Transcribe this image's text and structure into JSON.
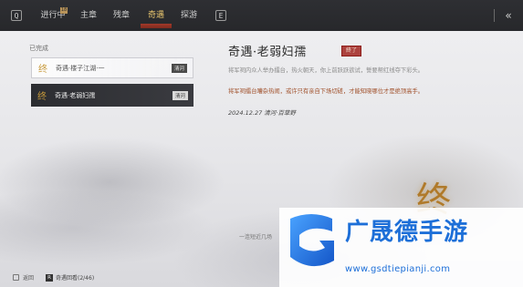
{
  "topbar": {
    "q_key": "Q",
    "e_key": "E",
    "badge": "18",
    "tabs": [
      {
        "label": "进行中"
      },
      {
        "label": "主章"
      },
      {
        "label": "残章"
      },
      {
        "label": "奇遇"
      },
      {
        "label": "探游"
      }
    ],
    "active_tab": "奇遇",
    "collapse_symbol": "«"
  },
  "list": {
    "section_label": "已完成",
    "items": [
      {
        "symbol": "终",
        "title": "奇遇·楼子江湖·一",
        "region": "清河"
      },
      {
        "symbol": "终",
        "title": "奇遇·老弱妇孺",
        "region": "清河"
      }
    ]
  },
  "detail": {
    "title": "奇遇·老弱妇孺",
    "stamp": "終了",
    "para1": "将军祠内众人举办擂台，热火朝天，你上前跃跃欲试，誓要帮红线夺下彩头。",
    "para2": "将军祠擂台嘈杂热闹，或许只有亲自下场切磋，才能知晓哪位才是绝顶高手。",
    "meta": "2024.12.27 清河·百草野",
    "big_char": "终",
    "faint": "一连短近几场"
  },
  "bottom": {
    "esc_label": "返回",
    "r_key": "R",
    "r_label": "奇遇回看(2/46)"
  },
  "watermark": {
    "name": "广晟德手游",
    "url": "www.gsdtiepianji.com"
  },
  "colors": {
    "accent_gold": "#e8c56e",
    "active_red": "#a13a2a",
    "brand_blue": "#1d6fd8"
  }
}
